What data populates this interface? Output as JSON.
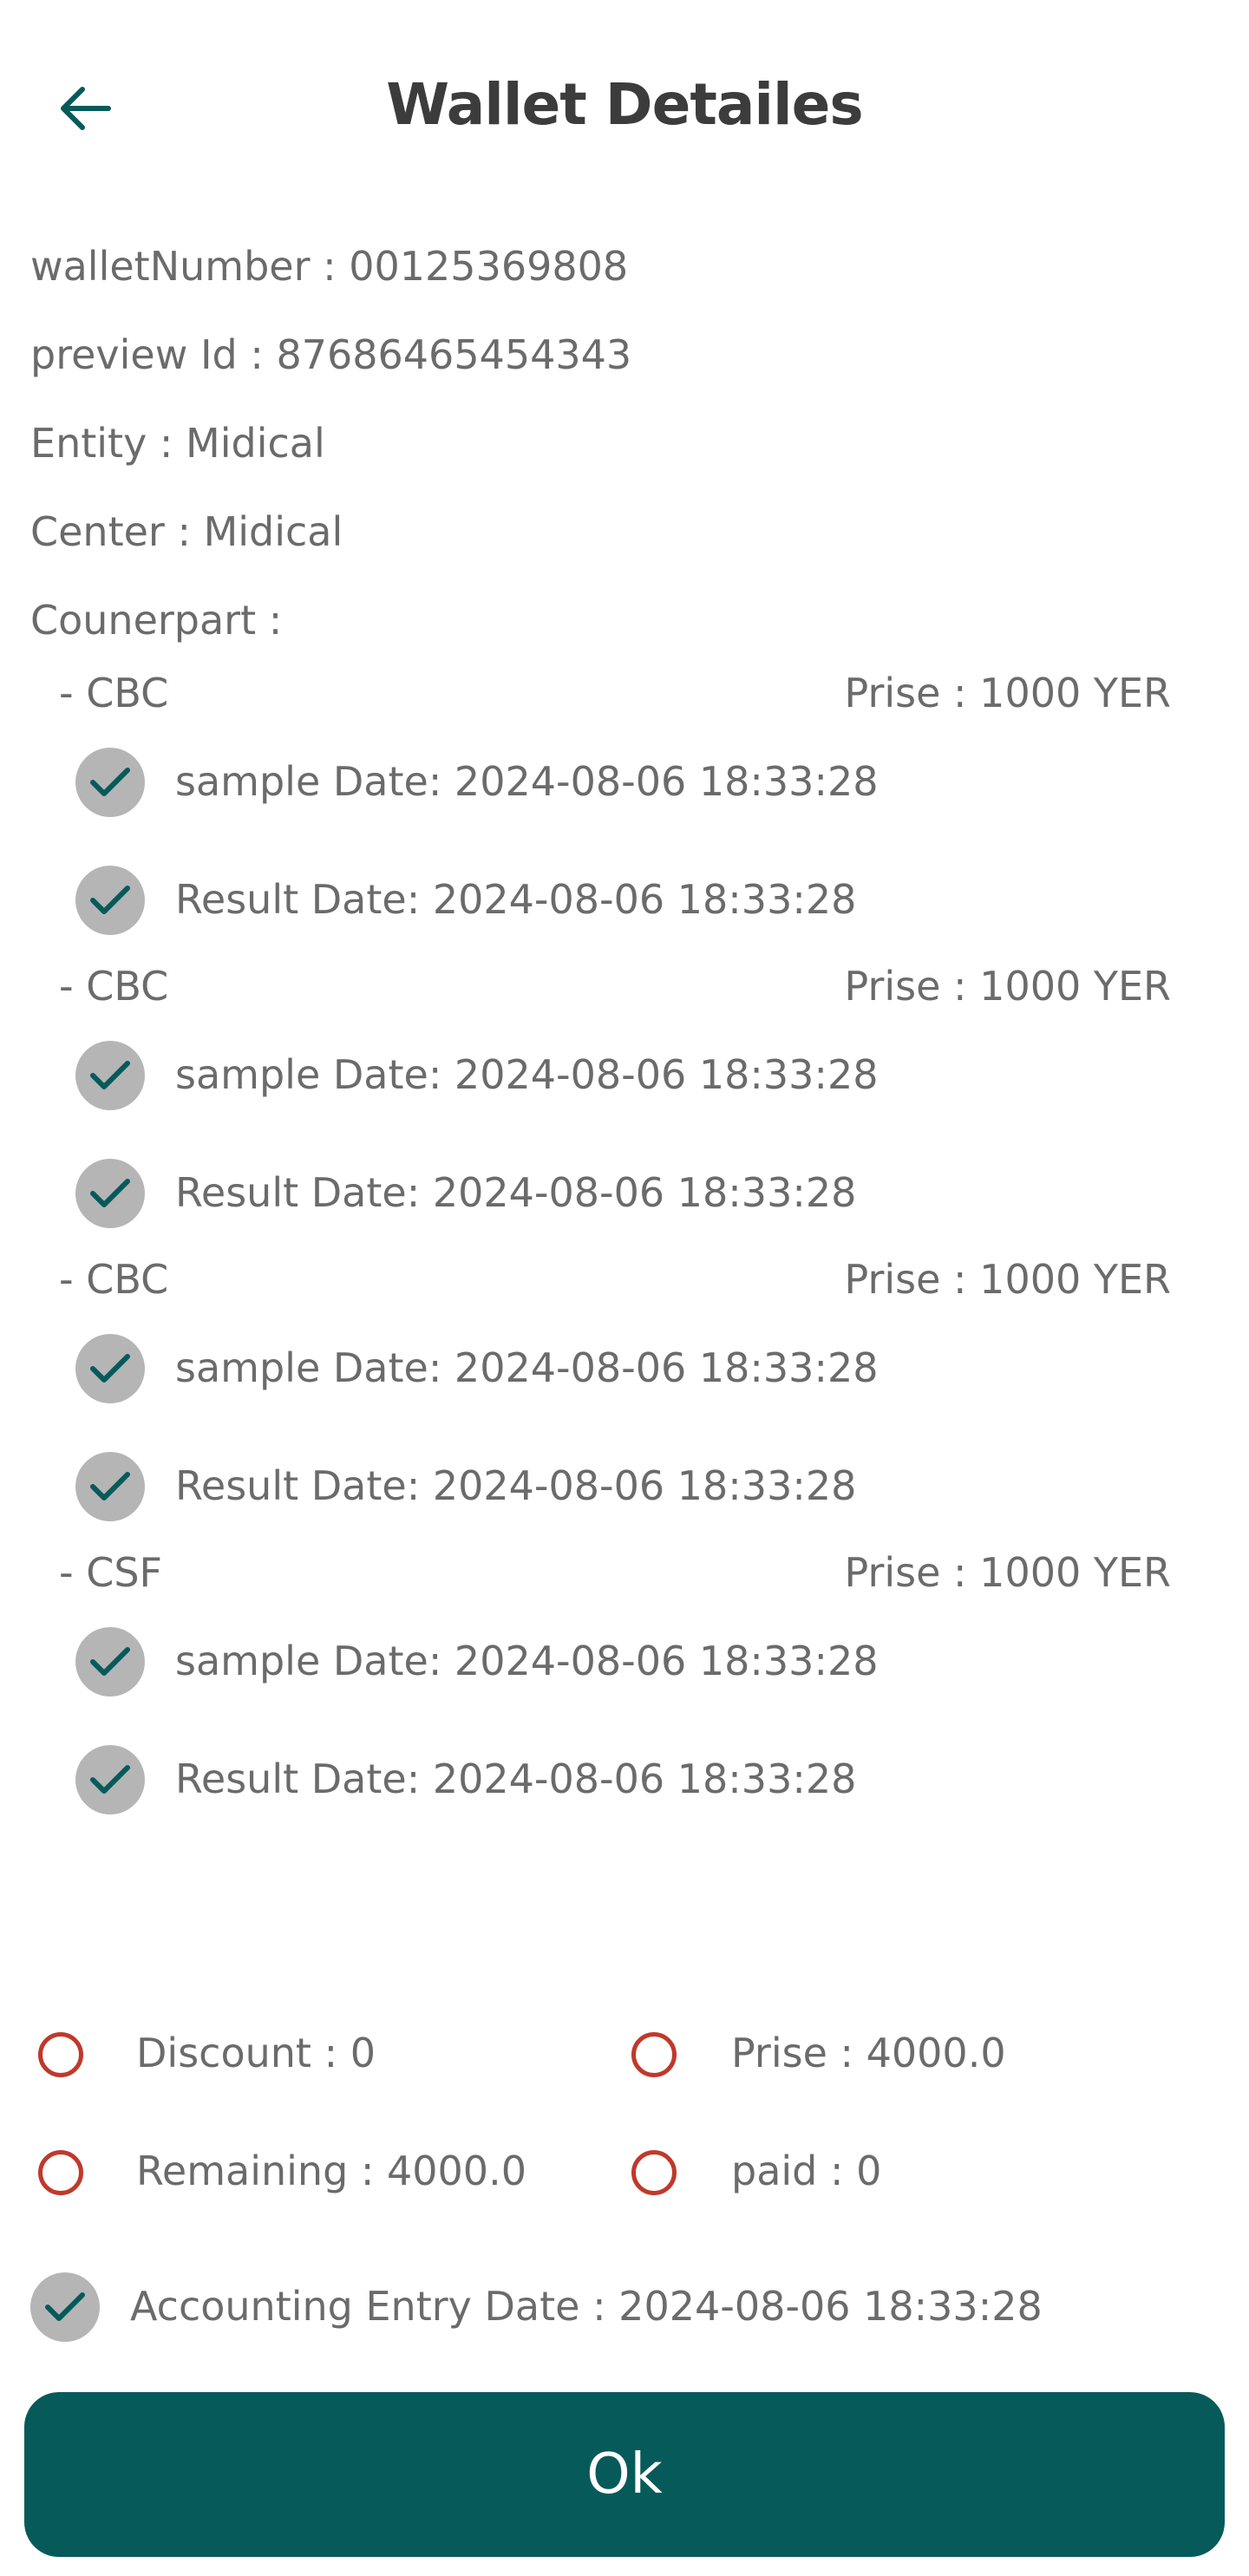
{
  "header": {
    "title": "Wallet Detailes",
    "back_icon": "arrow-left-icon"
  },
  "colors": {
    "primary": "#075a5a",
    "check_bg": "#b5b5b5",
    "radio_border": "#c0392b",
    "text": "#6b6b6b"
  },
  "info": {
    "wallet_number": "walletNumber : 00125369808",
    "preview_id": "preview Id : 87686465454343",
    "entity": "Entity : Midical",
    "center": "Center : Midical",
    "counterpart": "Counerpart :"
  },
  "tests": [
    {
      "name": "- CBC",
      "price": "Prise : 1000 YER",
      "sample_date": "sample Date: 2024-08-06 18:33:28",
      "result_date": "Result Date: 2024-08-06 18:33:28"
    },
    {
      "name": "- CBC",
      "price": "Prise : 1000 YER",
      "sample_date": "sample Date: 2024-08-06 18:33:28",
      "result_date": "Result Date: 2024-08-06 18:33:28"
    },
    {
      "name": "- CBC",
      "price": "Prise : 1000 YER",
      "sample_date": "sample Date: 2024-08-06 18:33:28",
      "result_date": "Result Date: 2024-08-06 18:33:28"
    },
    {
      "name": "- CSF",
      "price": "Prise : 1000 YER",
      "sample_date": "sample Date: 2024-08-06 18:33:28",
      "result_date": "Result Date: 2024-08-06 18:33:28"
    }
  ],
  "summary": {
    "discount": "Discount : 0",
    "prise": "Prise : 4000.0",
    "remaining": "Remaining : 4000.0",
    "paid": "paid : 0",
    "accounting_entry_date": "Accounting Entry Date  : 2024-08-06 18:33:28"
  },
  "ok_button": {
    "label": "Ok"
  }
}
